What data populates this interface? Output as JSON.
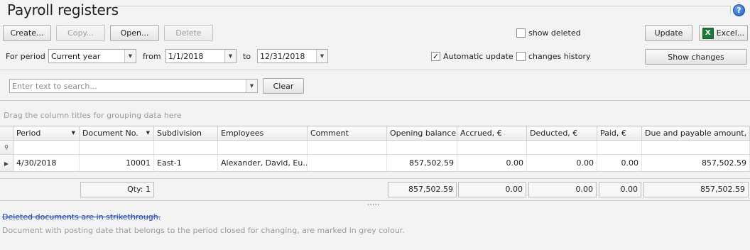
{
  "header": {
    "title": "Payroll registers",
    "help_glyph": "?"
  },
  "toolbar": {
    "create": "Create...",
    "copy": "Copy...",
    "open": "Open...",
    "delete": "Delete",
    "show_deleted": "show deleted",
    "update": "Update",
    "excel": "Excel...",
    "excel_icon": "excel-icon"
  },
  "filters": {
    "period_label": "For period",
    "period_value": "Current year",
    "from_label": "from",
    "from_value": "1/1/2018",
    "to_label": "to",
    "to_value": "12/31/2018",
    "automatic_update": "Automatic update",
    "automatic_update_checked": true,
    "changes_history": "changes history",
    "changes_history_checked": false,
    "show_changes": "Show changes"
  },
  "search": {
    "placeholder": "Enter text to search...",
    "clear": "Clear"
  },
  "grid": {
    "group_hint": "Drag the column titles for grouping data here",
    "columns": [
      "Period",
      "Document No.",
      "Subdivision",
      "Employees",
      "Comment",
      "Opening balance,",
      "Accrued, €",
      "Deducted, €",
      "Paid, €",
      "Due and payable amount, €"
    ],
    "rows": [
      [
        "4/30/2018",
        "10001",
        "East-1",
        "Alexander, David, Eu...",
        "",
        "857,502.59",
        "0.00",
        "0.00",
        "0.00",
        "857,502.59"
      ]
    ],
    "totals": {
      "qty": "Qty: 1",
      "opening": "857,502.59",
      "accrued": "0.00",
      "deducted": "0.00",
      "paid": "0.00",
      "due": "857,502.59"
    }
  },
  "notes": {
    "deleted": "Deleted documents are in strikethrough.",
    "closed_period": "Document with posting date that belongs to the period closed for changing, are marked in grey colour."
  },
  "colors": {
    "note_blue": "#1a44b8",
    "hint_grey": "#9a9a9a"
  }
}
